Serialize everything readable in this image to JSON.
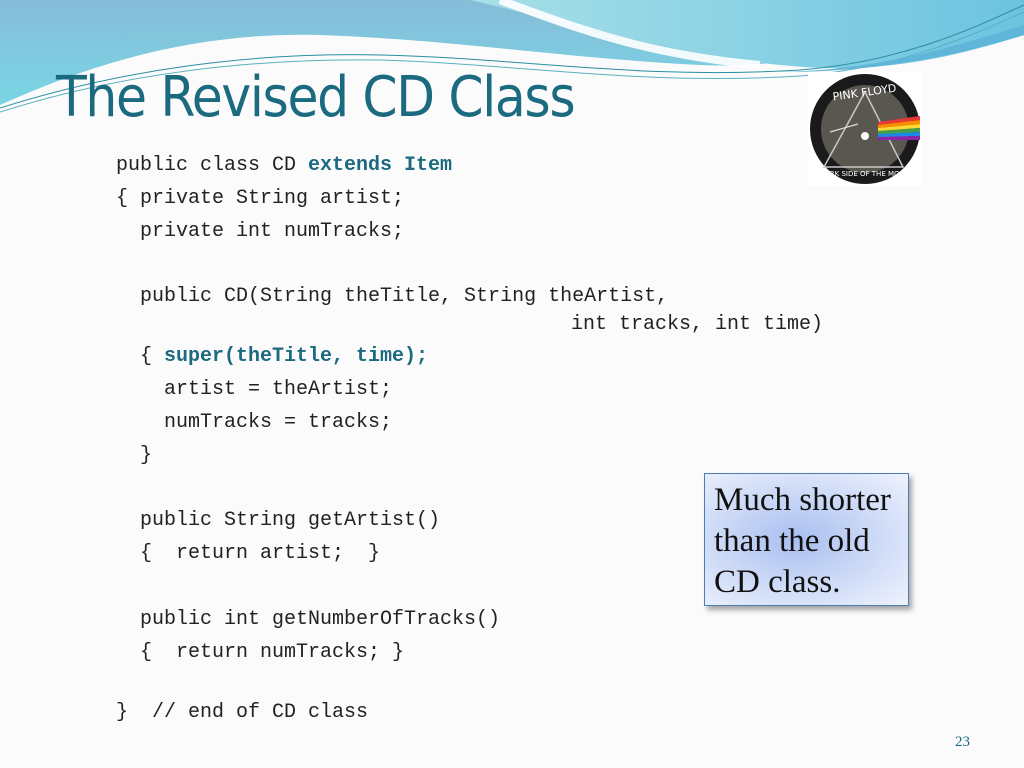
{
  "slide": {
    "title": "The Revised CD Class",
    "page_number": "23",
    "accent_color": "#1b6a80",
    "logo": {
      "icon": "pink-floyd-dark-side-of-the-moon-icon",
      "top_text": "PINK FLOYD",
      "bottom_text": "DARK SIDE OF THE MOON"
    },
    "code": {
      "lines": [
        {
          "text": "public class CD ",
          "highlight": "extends Item"
        },
        {
          "text": "{ private String artist;"
        },
        {
          "text": "  private int numTracks;"
        },
        {
          "text": "  public CD(String theTitle, String theArtist,"
        },
        {
          "text": "int tracks, int time)"
        },
        {
          "text": "  { ",
          "highlight": "super(theTitle, time);"
        },
        {
          "text": "    artist = theArtist;"
        },
        {
          "text": "    numTracks = tracks;"
        },
        {
          "text": "  }"
        },
        {
          "text": "  public String getArtist()"
        },
        {
          "text": "  {  return artist;  }"
        },
        {
          "text": "  public int getNumberOfTracks()"
        },
        {
          "text": "  {  return numTracks; }"
        },
        {
          "text": "}  // end of CD class"
        }
      ]
    },
    "callout": {
      "text": "Much shorter\nthan the old\nCD class."
    }
  }
}
